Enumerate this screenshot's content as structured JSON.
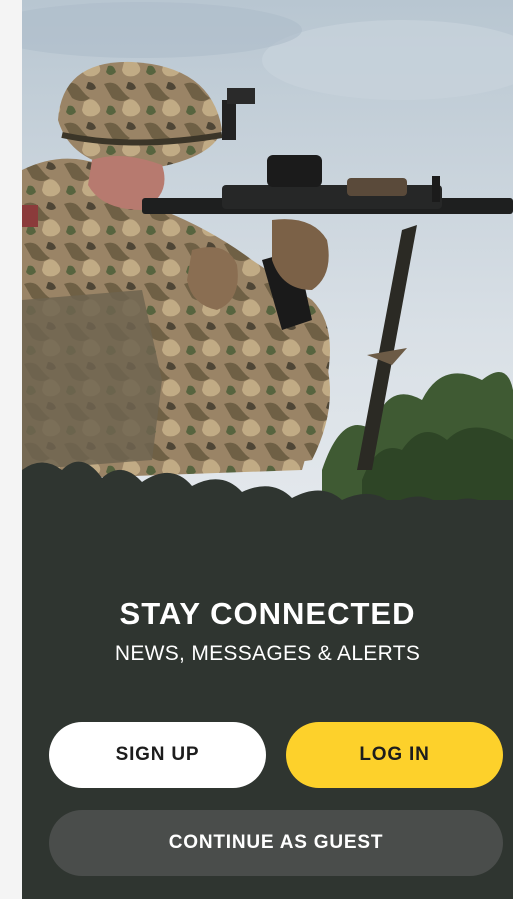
{
  "hero": {
    "image_subject": "soldier-aiming-rifle-photo"
  },
  "headline": "STAY CONNECTED",
  "subheadline": "NEWS, MESSAGES & ALERTS",
  "buttons": {
    "sign_up": "SIGN UP",
    "log_in": "LOG IN",
    "guest": "CONTINUE AS GUEST"
  },
  "colors": {
    "background": "#2f3530",
    "login_accent": "#fdd12b",
    "signup_bg": "#ffffff",
    "guest_bg": "#4a4d4b"
  }
}
